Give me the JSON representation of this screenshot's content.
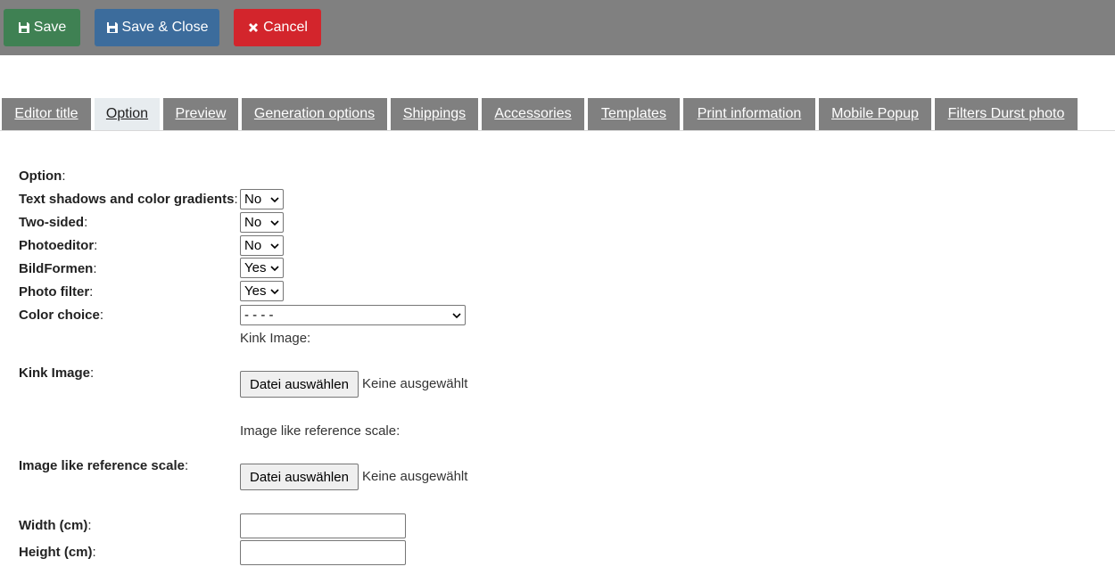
{
  "toolbar": {
    "save_label": "Save",
    "save_close_label": "Save & Close",
    "cancel_label": "Cancel"
  },
  "tabs": [
    {
      "label": "Editor title"
    },
    {
      "label": "Option"
    },
    {
      "label": "Preview"
    },
    {
      "label": "Generation options"
    },
    {
      "label": "Shippings"
    },
    {
      "label": "Accessories"
    },
    {
      "label": "Templates"
    },
    {
      "label": "Print information"
    },
    {
      "label": "Mobile Popup"
    },
    {
      "label": "Filters Durst photo"
    }
  ],
  "active_tab": "Option",
  "form": {
    "section_label": "Option",
    "fields": {
      "text_shadows": {
        "label": "Text shadows and color gradients",
        "value": "No"
      },
      "two_sided": {
        "label": "Two-sided",
        "value": "No"
      },
      "photoeditor": {
        "label": "Photoeditor",
        "value": "No"
      },
      "bildformen": {
        "label": "BildFormen",
        "value": "Yes"
      },
      "photo_filter": {
        "label": "Photo filter",
        "value": "Yes"
      },
      "color_choice": {
        "label": "Color choice",
        "value": "- - - -"
      },
      "kink_image": {
        "label": "Kink Image",
        "caption": "Kink Image:"
      },
      "reference_scale": {
        "label": "Image like reference scale",
        "caption": "Image like reference scale:"
      },
      "width": {
        "label": "Width (cm)",
        "value": ""
      },
      "height": {
        "label": "Height (cm)",
        "value": ""
      }
    },
    "file_button_label": "Datei auswählen",
    "file_none_label": "Keine ausgewählt",
    "colon": ":"
  },
  "colors": {
    "save": "#3f8153",
    "save_close": "#3c6c9c",
    "cancel": "#d3252c",
    "toolbar_bg": "#808080",
    "tab_bg": "#808080",
    "tab_active_bg": "#e7ecef"
  },
  "icons": {
    "save": "floppy-disk-icon",
    "save_close": "floppy-disk-icon",
    "cancel": "close-icon",
    "select": "chevron-down-icon"
  }
}
